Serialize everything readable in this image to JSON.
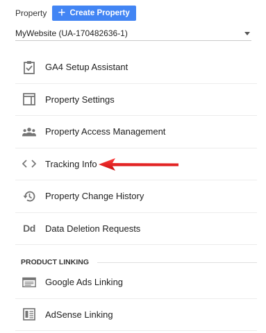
{
  "header": {
    "property_label": "Property",
    "create_button_label": "Create Property",
    "create_button_icon": "plus-icon"
  },
  "property_selector": {
    "selected": "MyWebsite (UA-170482636-1)"
  },
  "menu": {
    "items": [
      {
        "label": "GA4 Setup Assistant",
        "icon": "clipboard-check-icon"
      },
      {
        "label": "Property Settings",
        "icon": "layout-window-icon"
      },
      {
        "label": "Property Access Management",
        "icon": "people-icon"
      },
      {
        "label": "Tracking Info",
        "icon": "code-brackets-icon"
      },
      {
        "label": "Property Change History",
        "icon": "history-icon"
      },
      {
        "label": "Data Deletion Requests",
        "icon": "dd-icon",
        "icon_text": "Dd"
      }
    ]
  },
  "product_linking": {
    "title": "PRODUCT LINKING",
    "items": [
      {
        "label": "Google Ads Linking",
        "icon": "google-ads-icon"
      },
      {
        "label": "AdSense Linking",
        "icon": "adsense-icon"
      }
    ]
  },
  "colors": {
    "accent": "#4285f4",
    "icon": "#757575",
    "arrow": "#e31b1b"
  }
}
